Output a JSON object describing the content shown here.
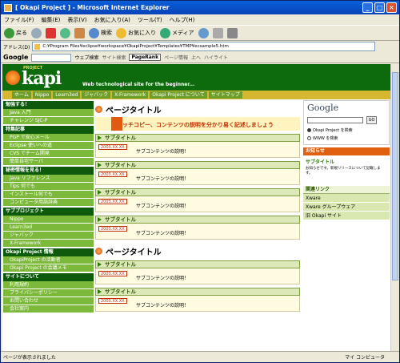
{
  "window": {
    "title": "[ Okapi Project ] - Microsoft Internet Explorer"
  },
  "menu": [
    "ファイル(F)",
    "編集(E)",
    "表示(V)",
    "お気に入り(A)",
    "ツール(T)",
    "ヘルプ(H)"
  ],
  "toolbar": {
    "back": "戻る",
    "search": "検索",
    "favorites": "お気に入り",
    "media": "メディア"
  },
  "address": {
    "label": "アドレス(D)",
    "value": "C:¥Program Files¥eclipse¥workspace¥OkapiProject¥Templates¥TMP¥ecsample5.htm"
  },
  "google_toolbar": {
    "logo": "Google",
    "web_search": "ウェブ検索",
    "site_search": "サイト検索",
    "pagerank": "PageRank",
    "page_info": "ページ情報",
    "up": "上へ",
    "highlight": "ハイライト"
  },
  "site": {
    "logo_top": "PROJECT",
    "logo_main": "kapi",
    "tagline": "Web technological site for the beginner...",
    "nav": [
      "ホーム",
      "Nippo",
      "Learn3ed",
      "ジャバック",
      "X-Framework",
      "Okapi Project について",
      "サイトマップ"
    ],
    "sidebar": [
      {
        "head": "勉強する！",
        "items": [
          "Java 入門",
          "チャレンジ SJC-P"
        ]
      },
      {
        "head": "特集記事",
        "items": [
          "PGP で安心メール",
          "Eclipse 使いへの道",
          "CVS でチーム開発",
          "簡単自宅サーバ"
        ]
      },
      {
        "head": "秘密情報を見る！",
        "items": [
          "Java リファレンス",
          "Tips 何でも",
          "インストール何でも",
          "コンピュータ用語辞典"
        ]
      },
      {
        "head": "サブプロジェクト",
        "items": [
          "Nippo",
          "Learn3ed",
          "ジャバック",
          "X-Framework"
        ]
      },
      {
        "head": "Okapi Project 情報",
        "items": [
          "OkapiProject の活動者",
          "Okapi Project の会議メモ"
        ]
      },
      {
        "head": "サイトについて",
        "items": [
          "利用規約",
          "プライバシーポリシー",
          "お問い合わせ",
          "会社案内"
        ]
      }
    ],
    "main": [
      {
        "title": "ページタイトル",
        "catch": "キャッチコピー、コンテンツの説明を分かり易く記述しましょう",
        "sections": [
          {
            "subtitle": "サブタイトル",
            "date": "2003.XX.XX",
            "text": "サブコンテンツの説明！"
          },
          {
            "subtitle": "サブタイトル",
            "date": "2003.XX.XX",
            "text": "サブコンテンツの説明！"
          },
          {
            "subtitle": "サブタイトル",
            "date": "2003.XX.XX",
            "text": "サブコンテンツの説明！"
          },
          {
            "subtitle": "サブタイトル",
            "date": "2003.XX.XX",
            "text": "サブコンテンツの説明！"
          }
        ]
      },
      {
        "title": "ページタイトル",
        "sections": [
          {
            "subtitle": "サブタイトル",
            "date": "2003.XX.XX",
            "text": "サブコンテンツの説明！"
          },
          {
            "subtitle": "サブタイトル",
            "date": "2003.XX.XX",
            "text": "サブコンテンツの説明！"
          }
        ]
      }
    ],
    "right": {
      "google_logo": "Google",
      "search_btn": "GO",
      "radio_site": "Okapi Project を検索",
      "radio_web": "WWW を検索",
      "news_head": "お知らせ",
      "news_title": "サブタイトル",
      "news_desc": "お知らせです。新規リリースについて記載します。",
      "links_head": "関連リンク",
      "links": [
        "Xware",
        "Xware グループウェア",
        "旧 Okapi サイト"
      ]
    }
  },
  "status": {
    "left": "ページが表示されました",
    "zone": "マイ コンピュータ"
  }
}
